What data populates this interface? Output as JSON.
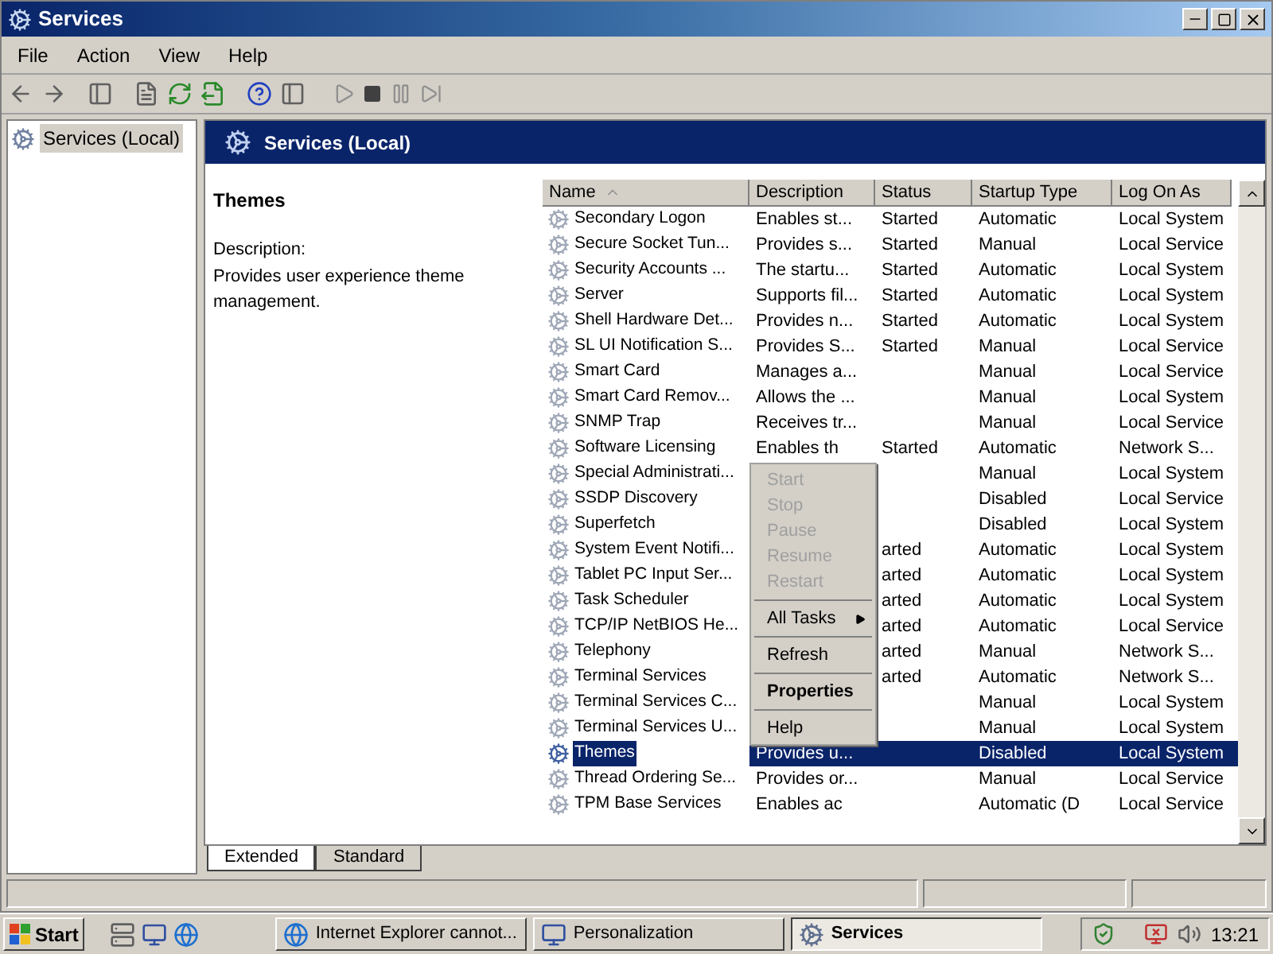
{
  "window": {
    "title": "Services"
  },
  "menu": [
    "File",
    "Action",
    "View",
    "Help"
  ],
  "tree": [
    {
      "label": "Services (Local)",
      "selected": true
    }
  ],
  "panel_title": "Services (Local)",
  "details": {
    "name": "Themes",
    "description_label": "Description:",
    "description": "Provides user experience theme management."
  },
  "table": {
    "columns": [
      "Name",
      "Description",
      "Status",
      "Startup Type",
      "Log On As"
    ],
    "rows": [
      {
        "name": "Secondary Logon",
        "description": "Enables st...",
        "status": "Started",
        "startup": "Automatic",
        "logon": "Local System",
        "selected": false
      },
      {
        "name": "Secure Socket Tun...",
        "description": "Provides s...",
        "status": "Started",
        "startup": "Manual",
        "logon": "Local Service",
        "selected": false
      },
      {
        "name": "Security Accounts ...",
        "description": "The startu...",
        "status": "Started",
        "startup": "Automatic",
        "logon": "Local System",
        "selected": false
      },
      {
        "name": "Server",
        "description": "Supports fil...",
        "status": "Started",
        "startup": "Automatic",
        "logon": "Local System",
        "selected": false
      },
      {
        "name": "Shell Hardware Det...",
        "description": "Provides n...",
        "status": "Started",
        "startup": "Automatic",
        "logon": "Local System",
        "selected": false
      },
      {
        "name": "SL UI Notification S...",
        "description": "Provides S...",
        "status": "Started",
        "startup": "Manual",
        "logon": "Local Service",
        "selected": false
      },
      {
        "name": "Smart Card",
        "description": "Manages a...",
        "startup": "Manual",
        "logon": "Local Service",
        "selected": false
      },
      {
        "name": "Smart Card Remov...",
        "description": "Allows the ...",
        "startup": "Manual",
        "logon": "Local System",
        "selected": false
      },
      {
        "name": "SNMP Trap",
        "description": "Receives tr...",
        "startup": "Manual",
        "logon": "Local Service",
        "selected": false
      },
      {
        "name": "Software Licensing",
        "description": "Enables th",
        "status": "Started",
        "startup": "Automatic",
        "logon": "Network S...",
        "selected": false
      },
      {
        "name": "Special Administrati...",
        "startup": "Manual",
        "logon": "Local System",
        "selected": false
      },
      {
        "name": "SSDP Discovery",
        "startup": "Disabled",
        "logon": "Local Service",
        "selected": false
      },
      {
        "name": "Superfetch",
        "startup": "Disabled",
        "logon": "Local System",
        "selected": false
      },
      {
        "name": "System Event Notifi...",
        "status": "arted",
        "startup": "Automatic",
        "logon": "Local System",
        "selected": false
      },
      {
        "name": "Tablet PC Input Ser...",
        "status": "arted",
        "startup": "Automatic",
        "logon": "Local System",
        "selected": false
      },
      {
        "name": "Task Scheduler",
        "status": "arted",
        "startup": "Automatic",
        "logon": "Local System",
        "selected": false
      },
      {
        "name": "TCP/IP NetBIOS He...",
        "status": "arted",
        "startup": "Automatic",
        "logon": "Local Service",
        "selected": false
      },
      {
        "name": "Telephony",
        "status": "arted",
        "startup": "Manual",
        "logon": "Network S...",
        "selected": false
      },
      {
        "name": "Terminal Services",
        "status": "arted",
        "startup": "Automatic",
        "logon": "Network S...",
        "selected": false
      },
      {
        "name": "Terminal Services C...",
        "startup": "Manual",
        "logon": "Local System",
        "selected": false
      },
      {
        "name": "Terminal Services U...",
        "startup": "Manual",
        "logon": "Local System",
        "selected": false
      },
      {
        "name": "Themes",
        "description": "Provides u...",
        "startup": "Disabled",
        "logon": "Local System",
        "selected": true
      },
      {
        "name": "Thread Ordering Se...",
        "description": "Provides or...",
        "startup": "Manual",
        "logon": "Local Service",
        "selected": false
      },
      {
        "name": "TPM Base Services",
        "description": "Enables ac",
        "startup": "Automatic (D",
        "logon": "Local Service",
        "selected": false
      }
    ]
  },
  "context_menu": [
    {
      "kind": "item",
      "label": "Start",
      "disabled": true,
      "bold": false
    },
    {
      "kind": "item",
      "label": "Stop",
      "disabled": true,
      "bold": false
    },
    {
      "kind": "item",
      "label": "Pause",
      "disabled": true,
      "bold": false
    },
    {
      "kind": "item",
      "label": "Resume",
      "disabled": true,
      "bold": false
    },
    {
      "kind": "item",
      "label": "Restart",
      "disabled": true,
      "bold": false
    },
    {
      "kind": "separator"
    },
    {
      "kind": "submenu",
      "label": "All Tasks",
      "disabled": false,
      "bold": false
    },
    {
      "kind": "separator"
    },
    {
      "kind": "item",
      "label": "Refresh",
      "disabled": false,
      "bold": false
    },
    {
      "kind": "separator"
    },
    {
      "kind": "item",
      "label": "Properties",
      "disabled": false,
      "bold": true
    },
    {
      "kind": "separator"
    },
    {
      "kind": "item",
      "label": "Help",
      "disabled": false,
      "bold": false
    }
  ],
  "view_tabs": [
    {
      "label": "Extended",
      "selected": true
    },
    {
      "label": "Standard",
      "selected": false
    }
  ],
  "taskbar": {
    "start": "Start",
    "tasks": [
      {
        "label": "Internet Explorer cannot...",
        "kind": "ie",
        "selected": false
      },
      {
        "label": "Personalization",
        "kind": "monitor",
        "selected": false
      },
      {
        "label": "Services",
        "kind": "gear",
        "selected": true
      }
    ],
    "clock": "13:21"
  }
}
